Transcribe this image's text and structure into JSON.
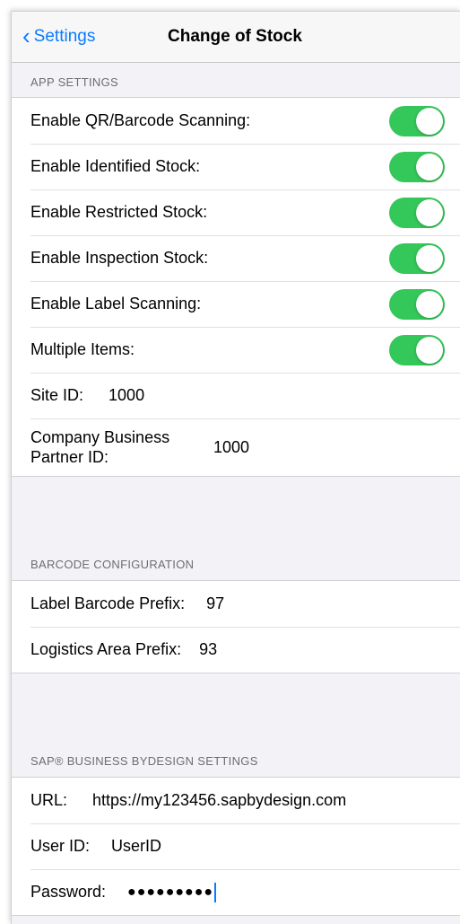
{
  "nav": {
    "back_label": "Settings",
    "title": "Change of Stock"
  },
  "app_settings": {
    "header": "APP SETTINGS",
    "toggles": [
      {
        "label": "Enable QR/Barcode Scanning:",
        "on": true
      },
      {
        "label": "Enable Identified Stock:",
        "on": true
      },
      {
        "label": "Enable Restricted Stock:",
        "on": true
      },
      {
        "label": "Enable Inspection Stock:",
        "on": true
      },
      {
        "label": "Enable Label Scanning:",
        "on": true
      },
      {
        "label": "Multiple Items:",
        "on": true
      }
    ],
    "site_id_label": "Site ID:",
    "site_id_value": "1000",
    "company_bp_label_line1": "Company Business",
    "company_bp_label_line2": "Partner ID:",
    "company_bp_value": "1000"
  },
  "barcode_config": {
    "header": "BARCODE CONFIGURATION",
    "label_prefix_label": "Label Barcode Prefix:",
    "label_prefix_value": "97",
    "logistics_prefix_label": "Logistics Area Prefix:",
    "logistics_prefix_value": "93"
  },
  "sap_settings": {
    "header": "SAP® BUSINESS BYDESIGN SETTINGS",
    "url_label": "URL:",
    "url_value": "https://my123456.sapbydesign.com",
    "user_id_label": "User ID:",
    "user_id_value": "UserID",
    "password_label": "Password:",
    "password_value": "●●●●●●●●●"
  },
  "colors": {
    "accent": "#0a7aff",
    "toggle_on": "#34c759"
  }
}
